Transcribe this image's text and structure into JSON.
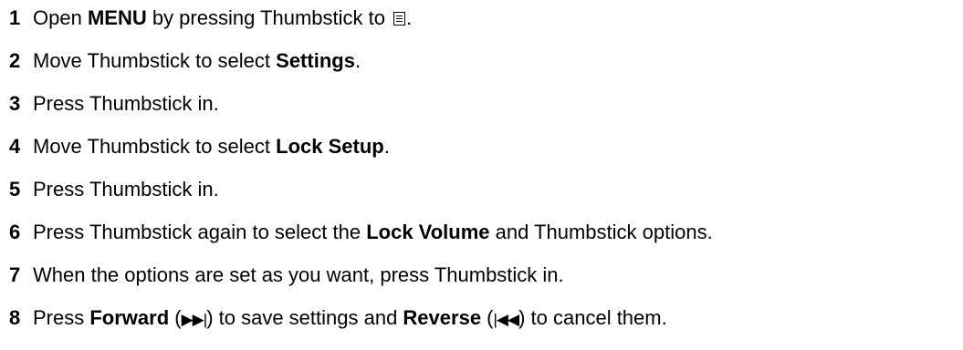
{
  "steps": [
    {
      "num": "1",
      "parts": [
        "Open ",
        "MENU",
        " by pressing Thumbstick to ",
        "."
      ],
      "icon": "menu-icon"
    },
    {
      "num": "2",
      "parts": [
        "Move Thumbstick to select ",
        "Settings",
        "."
      ]
    },
    {
      "num": "3",
      "text": "Press Thumbstick in."
    },
    {
      "num": "4",
      "parts": [
        "Move Thumbstick to select ",
        "Lock Setup",
        "."
      ]
    },
    {
      "num": "5",
      "text": "Press Thumbstick in."
    },
    {
      "num": "6",
      "parts": [
        "Press Thumbstick again to select the ",
        "Lock Volume",
        " and Thumbstick options."
      ]
    },
    {
      "num": "7",
      "text": "When the options are set as you want, press Thumbstick in."
    },
    {
      "num": "8",
      "parts": [
        "Press ",
        "Forward",
        " (",
        "▶▶|",
        ") to save settings and ",
        "Reverse",
        " (",
        "|◀◀",
        ") to cancel them."
      ]
    }
  ]
}
